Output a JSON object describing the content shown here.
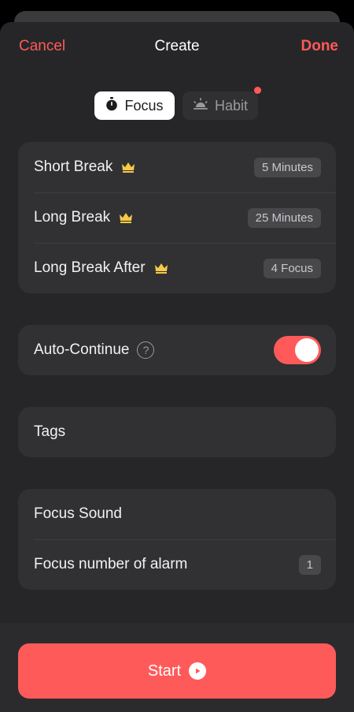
{
  "header": {
    "cancel_label": "Cancel",
    "title": "Create",
    "done_label": "Done"
  },
  "segments": [
    {
      "label": "Focus",
      "icon": "stopwatch-icon",
      "active": true
    },
    {
      "label": "Habit",
      "icon": "sunrise-icon",
      "active": false
    }
  ],
  "timing": {
    "rows": [
      {
        "label": "Short Break",
        "value": "5 Minutes",
        "icon": "crown-icon"
      },
      {
        "label": "Long Break",
        "value": "25 Minutes",
        "icon": "crown-icon"
      },
      {
        "label": "Long Break After",
        "value": "4 Focus",
        "icon": "crown-icon"
      }
    ]
  },
  "auto_continue": {
    "label": "Auto-Continue",
    "help_glyph": "?",
    "enabled": true
  },
  "tags": {
    "label": "Tags"
  },
  "sound": {
    "focus_sound_label": "Focus Sound",
    "alarm_label": "Focus number of alarm",
    "alarm_value": "1"
  },
  "footer": {
    "start_label": "Start"
  },
  "colors": {
    "accent": "#ff5a5a",
    "sheet": "#262628",
    "card": "#313133",
    "crown": "#f7c948"
  }
}
